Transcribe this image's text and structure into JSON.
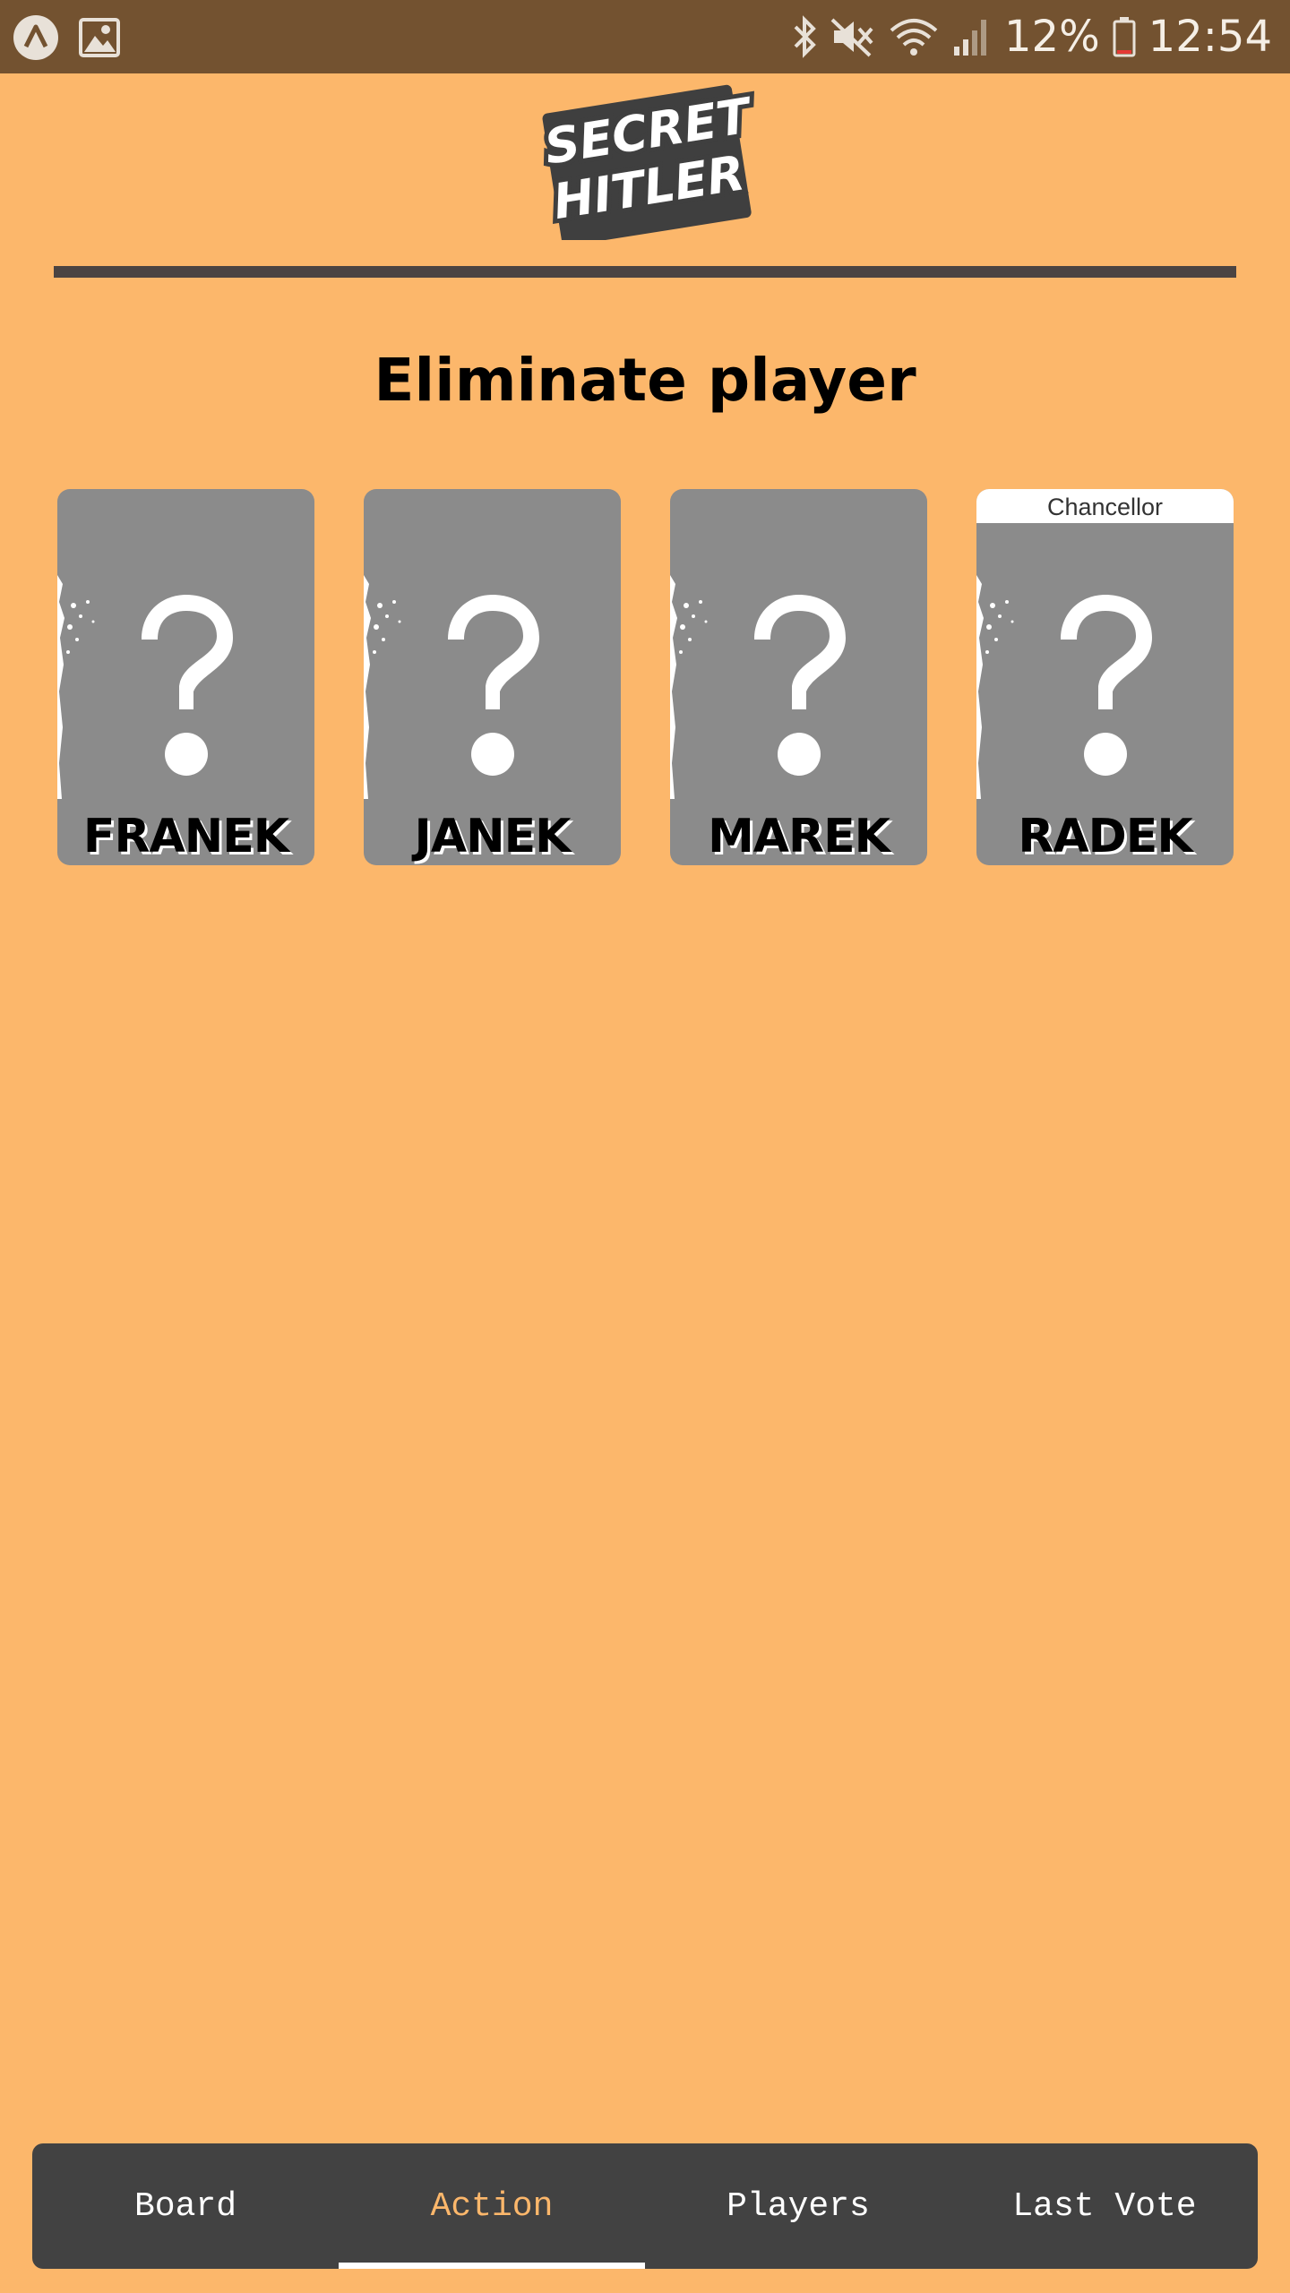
{
  "status_bar": {
    "battery": "12%",
    "time": "12:54",
    "icons": [
      "app-notification-icon",
      "image-notification-icon",
      "bluetooth-icon",
      "mute-icon",
      "wifi-icon",
      "cell-signal-icon",
      "battery-icon"
    ]
  },
  "header": {
    "logo_line1": "SECRET",
    "logo_line2": "HITLER"
  },
  "main": {
    "title": "Eliminate player",
    "players": [
      {
        "name": "FRANEK",
        "tag": ""
      },
      {
        "name": "JANEK",
        "tag": ""
      },
      {
        "name": "MAREK",
        "tag": ""
      },
      {
        "name": "RADEK",
        "tag": "Chancellor"
      }
    ]
  },
  "tabs": [
    {
      "label": "Board",
      "active": false
    },
    {
      "label": "Action",
      "active": true
    },
    {
      "label": "Players",
      "active": false
    },
    {
      "label": "Last Vote",
      "active": false
    }
  ],
  "colors": {
    "background": "#fcb76b",
    "status_bar": "#735230",
    "card": "#8b8b8b",
    "tab_bar": "#424242",
    "active_tab": "#fcb76b"
  }
}
